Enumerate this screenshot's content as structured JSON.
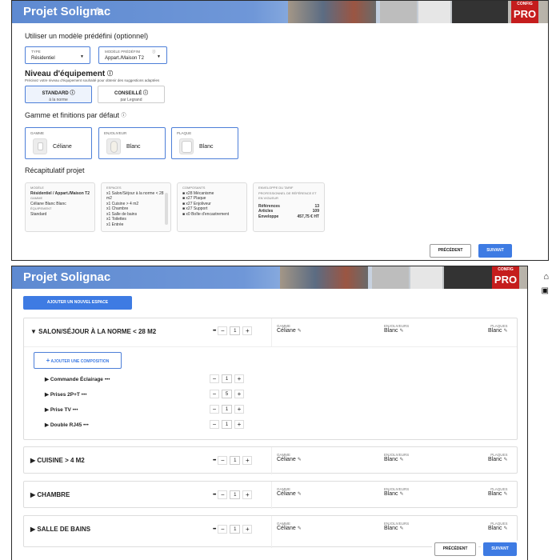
{
  "top": {
    "title": "Projet Solignac",
    "brand_small": "CONFIG",
    "brand": "PRO",
    "model_heading": "Utiliser un modèle prédéfini (optionnel)",
    "type": {
      "label": "TYPE",
      "value": "Résidentiel"
    },
    "modele": {
      "label": "MODÈLE PRÉDÉFINI",
      "value": "Appart./Maison T2"
    },
    "niveau_heading": "Niveau d'équipement",
    "niveau_desc": "Précisez votre niveau d'équipement souhaité pour obtenir des suggestions adaptées",
    "standard": {
      "title": "STANDARD",
      "sub": "à la norme"
    },
    "conseille": {
      "title": "CONSEILLÉ",
      "sub": "par Legrand"
    },
    "gamme_heading": "Gamme et finitions par défaut",
    "gamme": {
      "label": "GAMME",
      "value": "Céliane"
    },
    "enjoliveur": {
      "label": "ENJOLIVEUR",
      "value": "Blanc"
    },
    "plaque": {
      "label": "PLAQUE",
      "value": "Blanc"
    },
    "recap_heading": "Récapitulatif projet",
    "recap1": {
      "cap_modele": "MODÈLE",
      "modele": "Résidentiel / Appart./Maison T2",
      "cap_gamme": "GAMME",
      "gamme": "Céliane Blanc Blanc",
      "cap_equip": "ÉQUIPEMENT",
      "equip": "Standard"
    },
    "recap2": {
      "cap": "ESPACES",
      "items": [
        "x1 Salon/Séjour à la norme < 28 m2",
        "x1 Cuisine > 4 m2",
        "x1 Chambre",
        "x1 Salle de bains",
        "x1 Toilettes",
        "x1 Entrée"
      ]
    },
    "recap3": {
      "cap": "COMPOSANTS",
      "items": [
        "x28 Mécanisme",
        "x27 Plaque",
        "x27 Enjoliveur",
        "x27 Support",
        "x0 Boîte d'encastrement"
      ]
    },
    "recap4": {
      "cap": "ENVELOPPE DU TARIF PROFESSIONNEL DE RÉFÉRENCE ET EN VIGUEUR",
      "rows": [
        {
          "k": "Références",
          "v": "13"
        },
        {
          "k": "Articles",
          "v": "109"
        },
        {
          "k": "Enveloppe",
          "v": "457,75 € HT"
        }
      ]
    },
    "prev": "PRÉCÉDENT",
    "next": "SUIVANT"
  },
  "bottom": {
    "title": "Projet Solignac",
    "brand_small": "CONFIG",
    "brand": "PRO",
    "add_space": "AJOUTER UN NOUVEL ESPACE",
    "add_composition": "AJOUTER UNE COMPOSITION",
    "cap_gamme": "GAMME",
    "cap_enjoliveurs": "ENJOLIVEURS",
    "cap_plaques": "PLAQUES",
    "rooms": [
      {
        "name": "SALON/SÉJOUR À LA NORME < 28 M2",
        "qty": "1",
        "gamme": "Céliane",
        "enjoliveurs": "Blanc",
        "plaques": "Blanc"
      },
      {
        "name": "CUISINE > 4 M2",
        "qty": "1",
        "gamme": "Céliane",
        "enjoliveurs": "Blanc",
        "plaques": "Blanc"
      },
      {
        "name": "CHAMBRE",
        "qty": "1",
        "gamme": "Céliane",
        "enjoliveurs": "Blanc",
        "plaques": "Blanc"
      },
      {
        "name": "SALLE DE BAINS",
        "qty": "1",
        "gamme": "Céliane",
        "enjoliveurs": "Blanc",
        "plaques": "Blanc"
      }
    ],
    "compositions": [
      {
        "name": "Commande Éclairage",
        "qty": "1"
      },
      {
        "name": "Prises 2P+T",
        "qty": "5"
      },
      {
        "name": "Prise TV",
        "qty": "1"
      },
      {
        "name": "Double RJ45",
        "qty": "1"
      }
    ],
    "prev": "PRÉCÉDENT",
    "next": "SUIVANT"
  },
  "icons": {
    "home": "home-icon",
    "save": "save-icon",
    "pencil": "pencil-icon",
    "info": "info-icon"
  },
  "colors": {
    "accent": "#3e7be3",
    "header": "#6a93d6",
    "brand": "#c51d1d"
  }
}
